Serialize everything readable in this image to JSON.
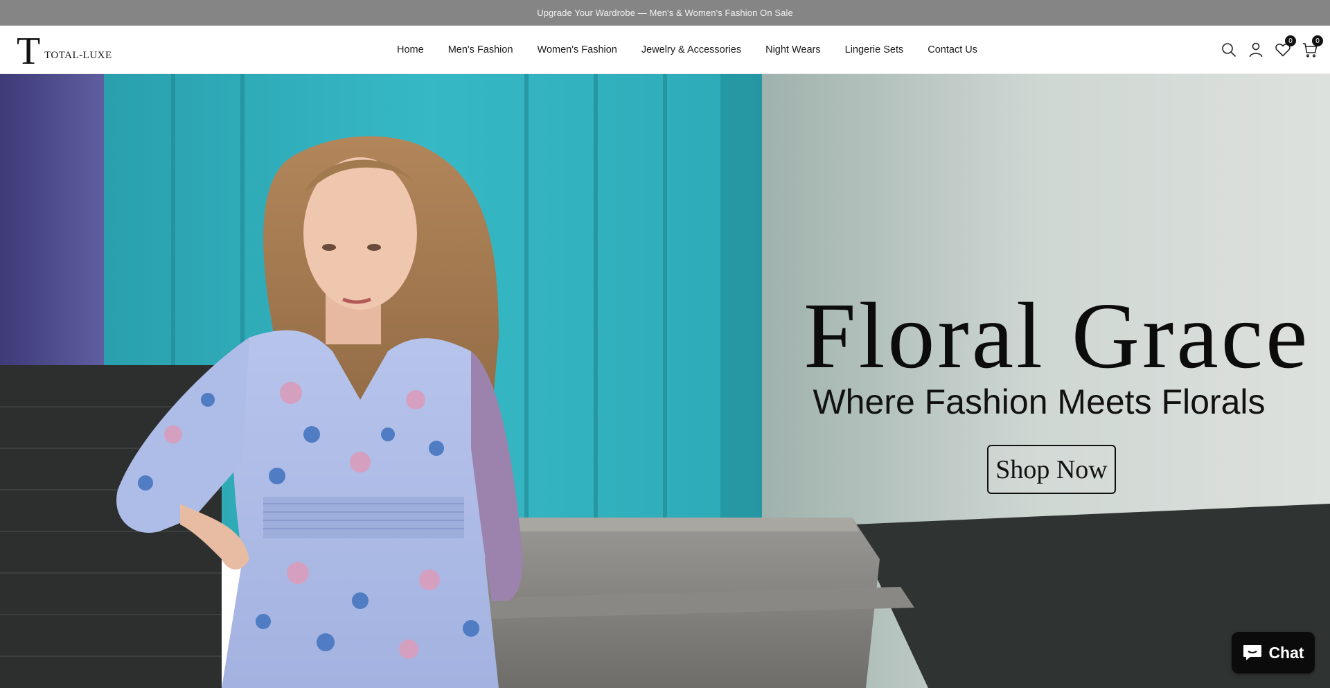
{
  "announcement": "Upgrade Your Wardrobe — Men's & Women's Fashion On Sale",
  "logo": {
    "text": "TOTAL-LUXE",
    "initial": "T"
  },
  "nav": [
    {
      "label": "Home"
    },
    {
      "label": "Men's Fashion"
    },
    {
      "label": "Women's Fashion"
    },
    {
      "label": "Jewelry & Accessories"
    },
    {
      "label": "Night Wears"
    },
    {
      "label": "Lingerie Sets"
    },
    {
      "label": "Contact Us"
    }
  ],
  "header_icons": {
    "search": "search-icon",
    "account": "user-icon",
    "wishlist": "heart-icon",
    "wishlist_count": "0",
    "cart": "shopping-bag-icon",
    "cart_count": "0"
  },
  "hero": {
    "title": "Floral Grace",
    "subtitle": "Where Fashion Meets Florals",
    "cta": "Shop Now"
  },
  "chat": {
    "label": "Chat",
    "icon": "chat-bubble-icon"
  },
  "colors": {
    "announcement_bg": "#858585",
    "teal_door": "#2fb3c0",
    "dress": "#aab9e4"
  }
}
